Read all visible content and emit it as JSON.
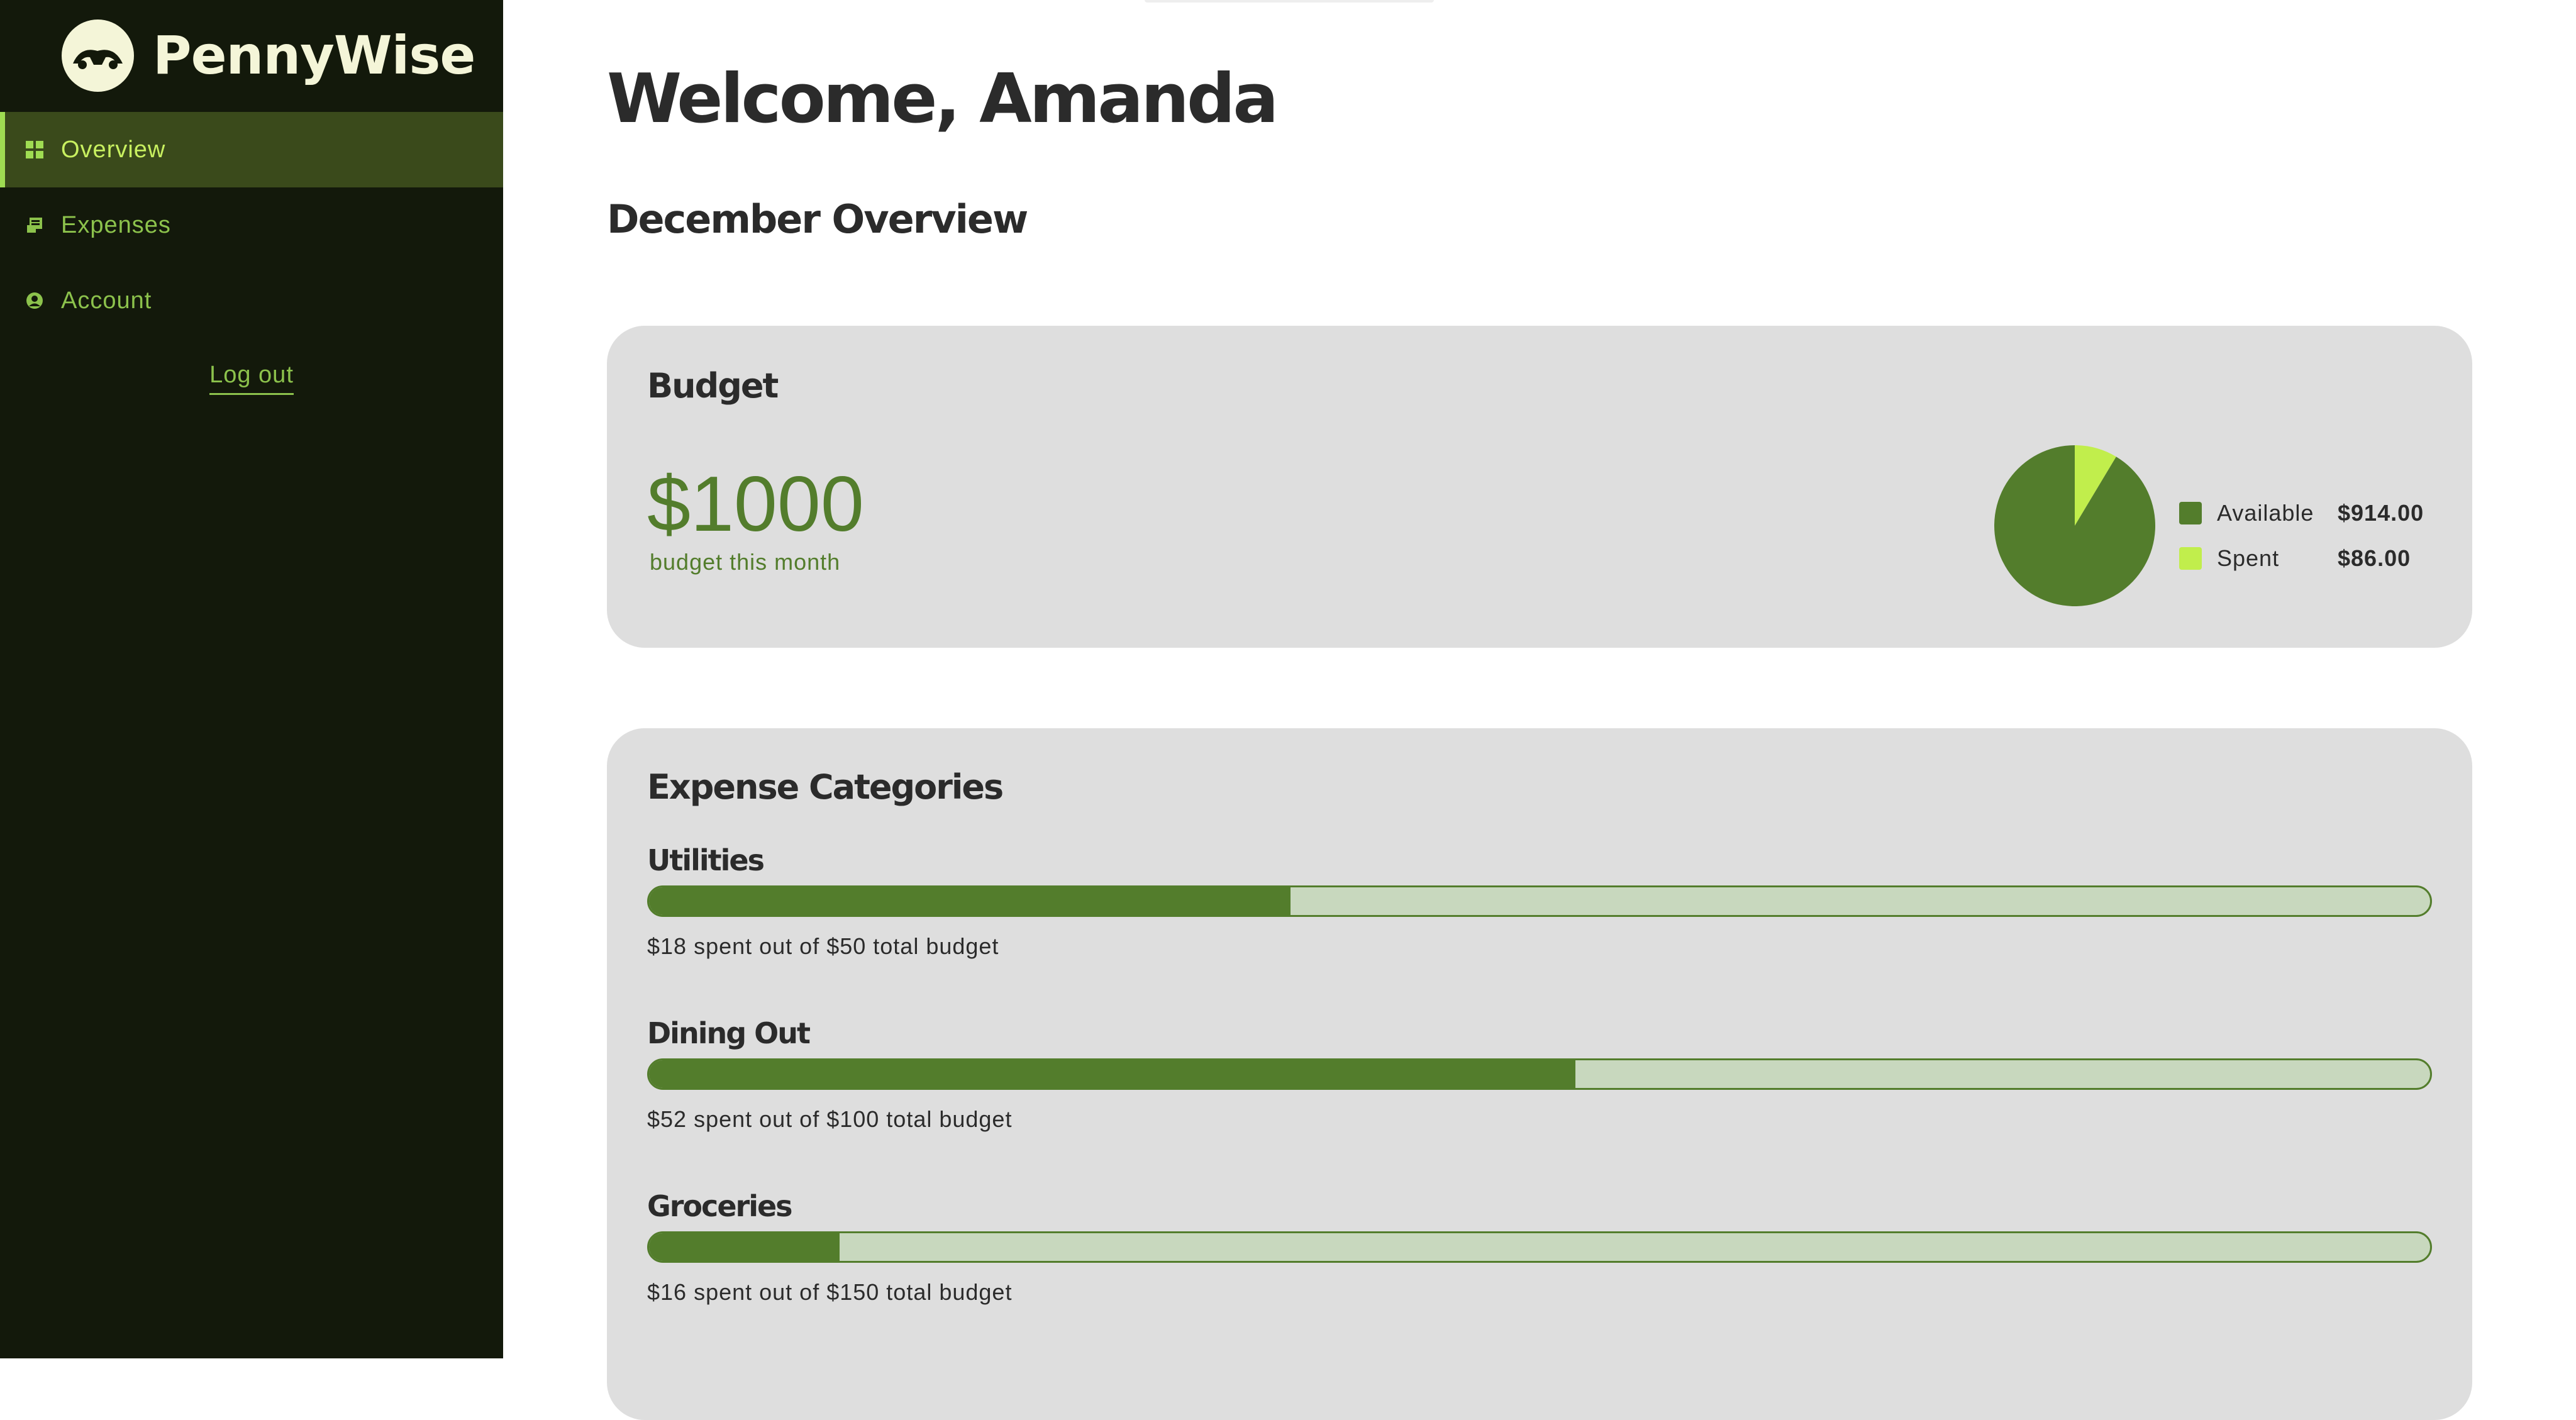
{
  "app": {
    "name": "PennyWise"
  },
  "colors": {
    "sidebar_bg": "#13190b",
    "accent": "#537d2c",
    "accent_light": "#c1ee4c",
    "card_bg": "#dedede"
  },
  "sidebar": {
    "items": [
      {
        "label": "Overview",
        "icon": "grid-icon",
        "active": true
      },
      {
        "label": "Expenses",
        "icon": "receipt-icon",
        "active": false
      },
      {
        "label": "Account",
        "icon": "user-circle-icon",
        "active": false
      }
    ],
    "logout_label": "Log out"
  },
  "main": {
    "welcome": "Welcome, Amanda",
    "subtitle": "December Overview",
    "budget": {
      "title": "Budget",
      "amount": "$1000",
      "caption": "budget this month",
      "legend": [
        {
          "label": "Available",
          "value": "$914.00",
          "color": "#537d2c"
        },
        {
          "label": "Spent",
          "value": "$86.00",
          "color": "#c1ee4c"
        }
      ]
    },
    "categories": {
      "title": "Expense Categories",
      "items": [
        {
          "name": "Utilities",
          "note": "$18 spent out of $50 total budget",
          "progress": 0.36
        },
        {
          "name": "Dining Out",
          "note": "$52 spent out of $100 total budget",
          "progress": 0.52
        },
        {
          "name": "Groceries",
          "note": "$16 spent out of $150 total budget",
          "progress": 0.107
        }
      ]
    }
  },
  "chart_data": {
    "type": "pie",
    "categories": [
      "Available",
      "Spent"
    ],
    "values": [
      914,
      86
    ]
  }
}
